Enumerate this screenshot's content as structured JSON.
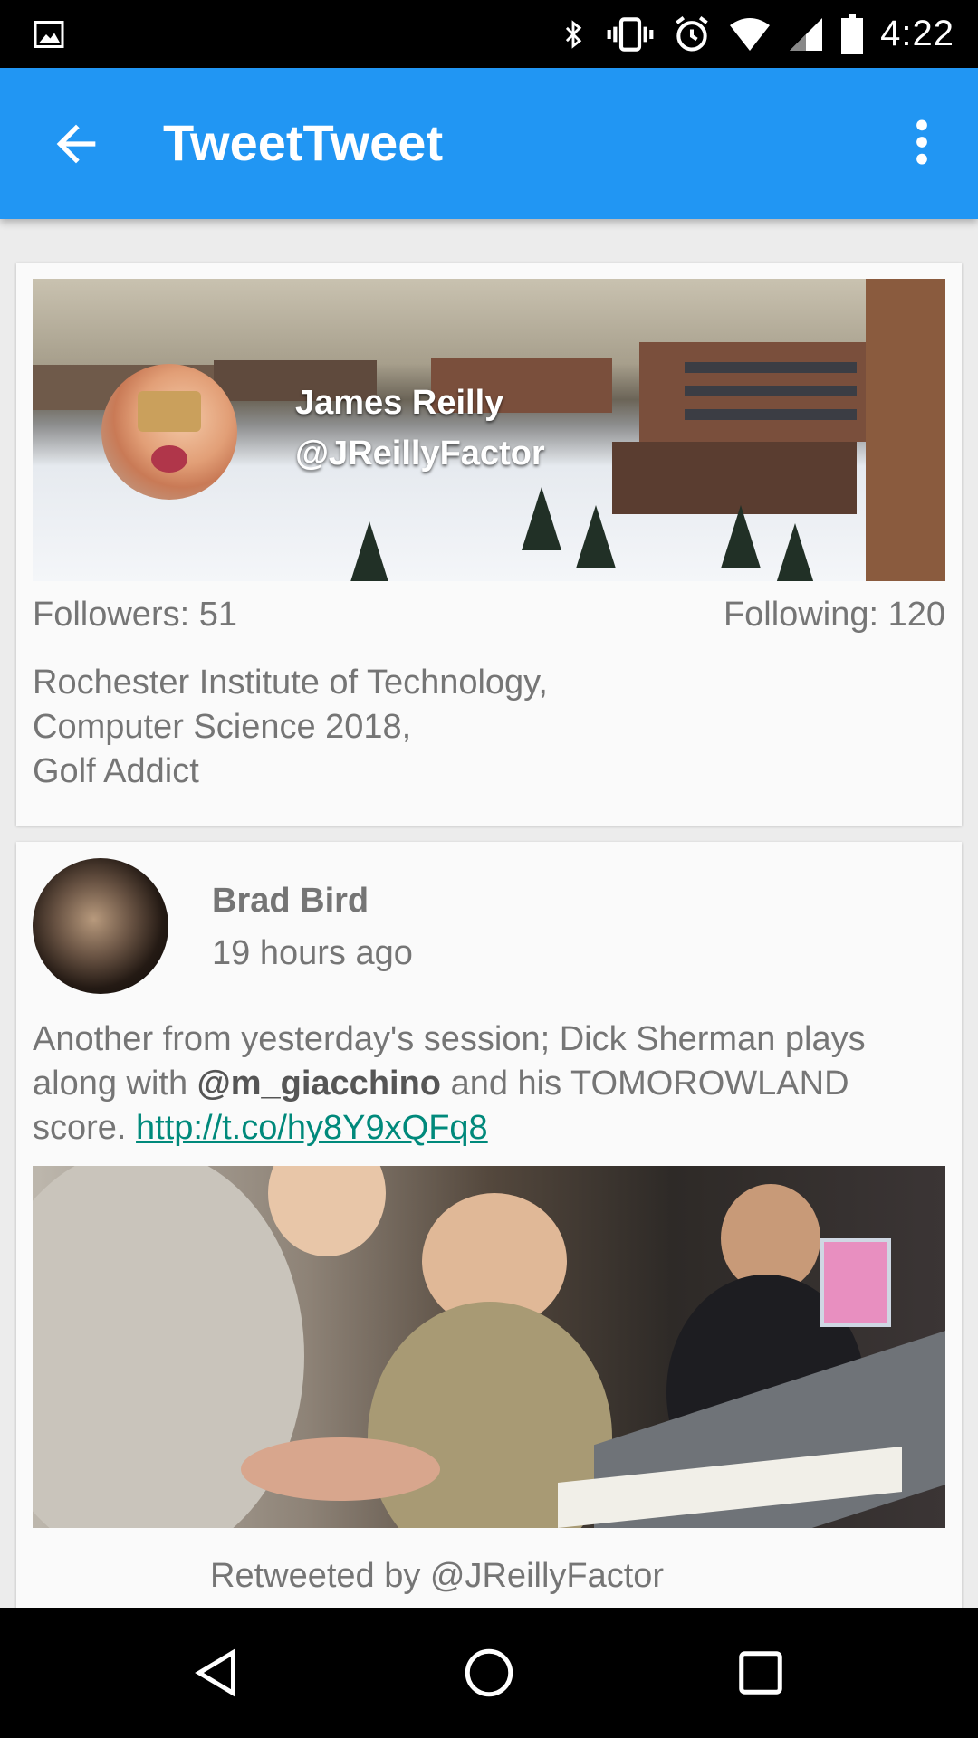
{
  "status_bar": {
    "time": "4:22",
    "icons": [
      "image-icon",
      "bluetooth-icon",
      "vibrate-icon",
      "alarm-icon",
      "wifi-icon",
      "signal-icon",
      "battery-icon"
    ]
  },
  "app_bar": {
    "title": "TweetTweet",
    "background_color": "#2196f3",
    "back_icon": "arrow-back-icon",
    "menu_icon": "more-vert-icon"
  },
  "profile": {
    "name": "James Reilly",
    "handle": "@JReillyFactor",
    "followers_text": "Followers: 51",
    "following_text": "Following: 120",
    "bio_lines": [
      "Rochester Institute of Technology,",
      "Computer Science 2018,",
      "Golf Addict"
    ]
  },
  "tweet": {
    "author": "Brad Bird",
    "time": "19 hours ago",
    "text_part1": "Another from yesterday's session; Dick Sherman plays along with ",
    "mention": "@m_giacchino",
    "text_part2": " and his TOMOROWLAND score. ",
    "link": "http://t.co/hy8Y9xQFq8",
    "link_color": "#00897b",
    "retweeted_by": "Retweeted by @JReillyFactor"
  },
  "nav_bar": {
    "icons": [
      "back-triangle-icon",
      "home-circle-icon",
      "recents-square-icon"
    ]
  }
}
